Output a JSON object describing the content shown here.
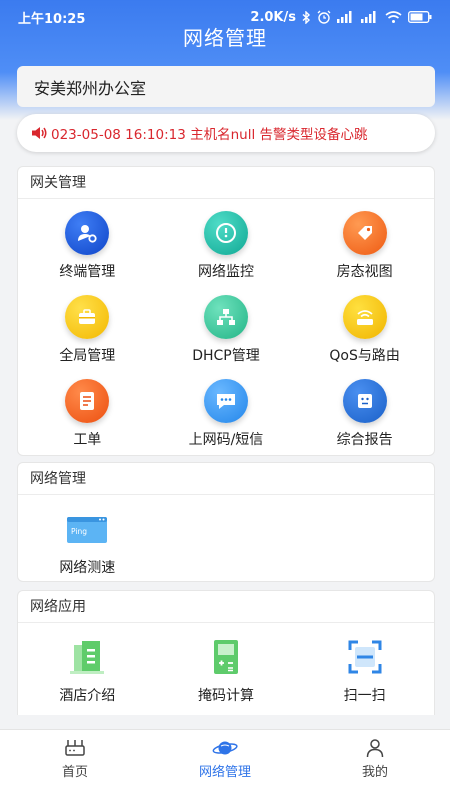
{
  "status_bar": {
    "time": "上午10:25",
    "speed": "2.0K/s"
  },
  "header": {
    "title": "网络管理"
  },
  "office": {
    "name": "安美郑州办公室"
  },
  "alert": {
    "message": "023-05-08 16:10:13 主机名null 告警类型设备心跳"
  },
  "gateway": {
    "title": "网关管理",
    "items": [
      {
        "label": "终端管理",
        "icon": "user-settings-icon",
        "color": "#1a56db"
      },
      {
        "label": "网络监控",
        "icon": "monitor-icon",
        "color": "#18b8a5"
      },
      {
        "label": "房态视图",
        "icon": "tag-icon",
        "color": "#f06a1c"
      },
      {
        "label": "全局管理",
        "icon": "briefcase-icon",
        "color": "#f7c600"
      },
      {
        "label": "DHCP管理",
        "icon": "network-tree-icon",
        "color": "#2fc59a"
      },
      {
        "label": "QoS与路由",
        "icon": "router-icon",
        "color": "#f5c500"
      },
      {
        "label": "工单",
        "icon": "document-icon",
        "color": "#f4621f"
      },
      {
        "label": "上网码/短信",
        "icon": "message-icon",
        "color": "#3197ef"
      },
      {
        "label": "综合报告",
        "icon": "report-icon",
        "color": "#1f6fd6"
      }
    ]
  },
  "network": {
    "title": "网络管理",
    "items": [
      {
        "label": "网络测速",
        "icon": "ping-window-icon",
        "badge": "Ping"
      }
    ]
  },
  "apps": {
    "title": "网络应用",
    "items": [
      {
        "label": "酒店介绍",
        "icon": "hotel-building-icon"
      },
      {
        "label": "掩码计算",
        "icon": "calculator-icon"
      },
      {
        "label": "扫一扫",
        "icon": "scan-icon"
      }
    ]
  },
  "tabs": [
    {
      "label": "首页",
      "icon": "router-device-icon"
    },
    {
      "label": "网络管理",
      "icon": "planet-icon",
      "active": true
    },
    {
      "label": "我的",
      "icon": "person-icon"
    }
  ],
  "colors": {
    "primary": "#2f74e8",
    "alert": "#d9272e"
  }
}
